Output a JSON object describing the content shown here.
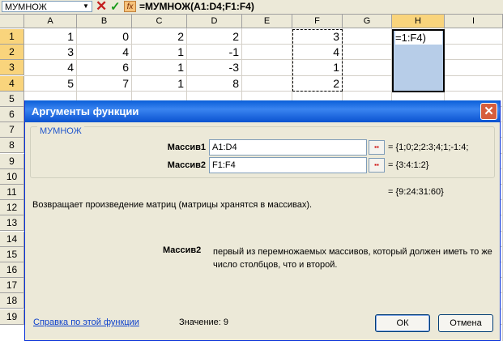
{
  "formula_bar": {
    "name_box": "МУМНОЖ",
    "cancel_symbol": "✕",
    "enter_symbol": "✓",
    "fx_label": "fx",
    "formula": "=МУМНОЖ(A1:D4;F1:F4)"
  },
  "grid": {
    "columns": [
      "A",
      "B",
      "C",
      "D",
      "E",
      "F",
      "G",
      "H",
      "I"
    ],
    "rows": [
      "1",
      "2",
      "3",
      "4",
      "5",
      "6",
      "7",
      "8",
      "9",
      "10",
      "11",
      "12",
      "13",
      "14",
      "15",
      "16",
      "17",
      "18",
      "19"
    ],
    "selected_column": "H",
    "selected_rows": [
      "1",
      "2",
      "3",
      "4"
    ],
    "cells": {
      "A1": "1",
      "B1": "0",
      "C1": "2",
      "D1": "2",
      "F1": "3",
      "A2": "3",
      "B2": "4",
      "C2": "1",
      "D2": "-1",
      "F2": "4",
      "A3": "4",
      "B3": "6",
      "C3": "1",
      "D3": "-3",
      "F3": "1",
      "A4": "5",
      "B4": "7",
      "C4": "1",
      "D4": "8",
      "F4": "2"
    },
    "h1_edit_text": "=1:F4)"
  },
  "dialog": {
    "title": "Аргументы функции",
    "close_symbol": "✕",
    "function_name": "МУМНОЖ",
    "args": [
      {
        "label": "Массив1",
        "value": "A1:D4",
        "result": "= {1;0;2;2:3;4;1;-1:4;"
      },
      {
        "label": "Массив2",
        "value": "F1:F4",
        "result": "= {3:4:1:2}"
      }
    ],
    "formula_result": "= {9:24:31:60}",
    "description": "Возвращает произведение матриц (матрицы хранятся в массивах).",
    "arg_help_name": "Массив2",
    "arg_help_text": "первый из перемножаемых массивов, который должен иметь то же число столбцов, что и второй.",
    "help_link": "Справка по этой функции",
    "value_label": "Значение:",
    "value": "9",
    "ok_label": "ОК",
    "cancel_label": "Отмена"
  },
  "colors": {
    "title_bar": "#0a5fd8",
    "selection_fill": "#b7cde8",
    "header_highlight": "#f9d47c",
    "link": "#0b3fcc"
  }
}
